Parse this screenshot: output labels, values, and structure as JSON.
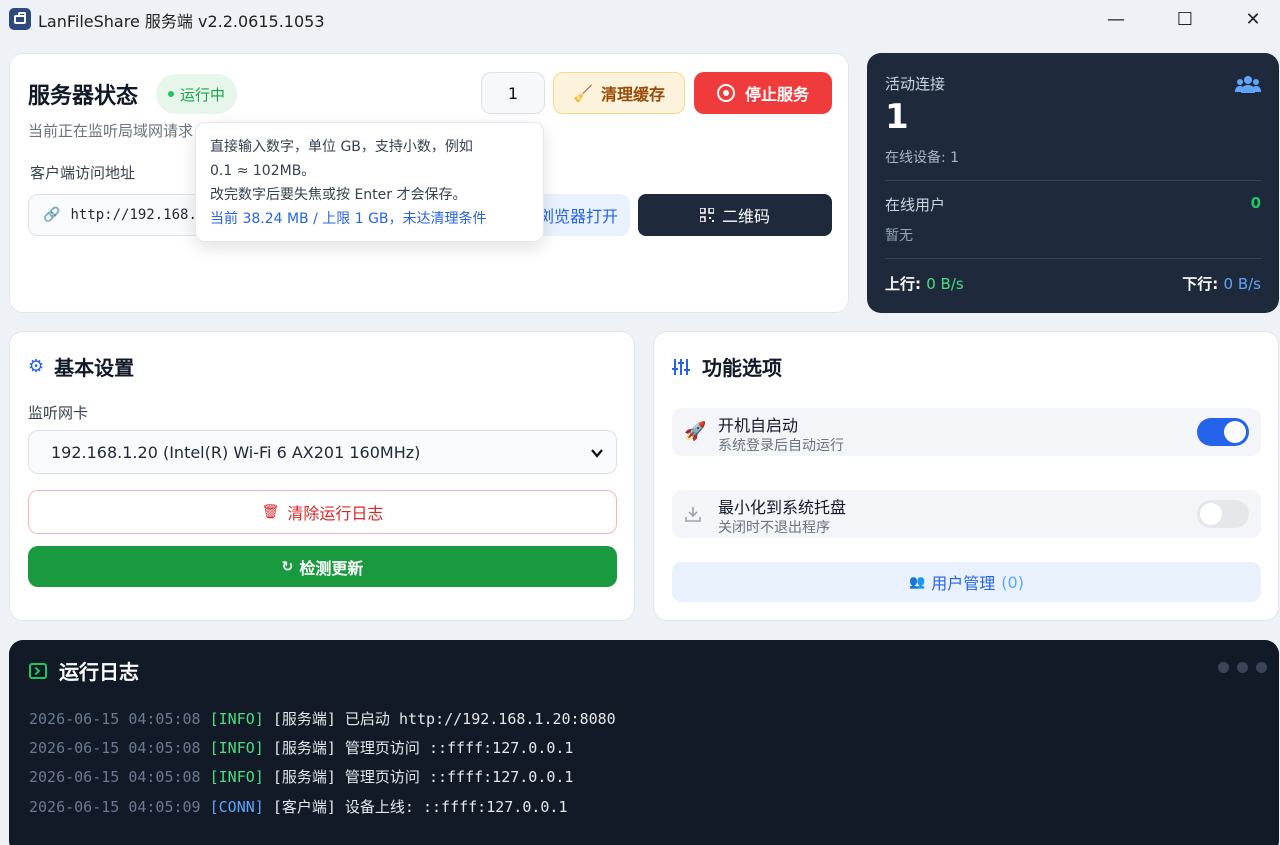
{
  "window": {
    "title": "LanFileShare 服务端 v2.2.0615.1053",
    "minimize": "—",
    "maximize": "☐",
    "close": "✕"
  },
  "status": {
    "title": "服务器状态",
    "badge": "运行中",
    "subtitle": "当前正在监听局域网请求",
    "cache_value": "1",
    "clear_cache_label": "清理缓存",
    "stop_label": "停止服务",
    "address_label": "客户端访问地址",
    "address_value": "http://192.168.1.20:8080",
    "open_browser_label": "浏览器打开",
    "qr_label": "二维码"
  },
  "tooltip": {
    "line1": "直接输入数字，单位 GB，支持小数，例如",
    "line2": "0.1 ≈ 102MB。",
    "line3": "改完数字后要失焦或按 Enter 才会保存。",
    "line4": "当前 38.24 MB / 上限 1 GB，未达清理条件"
  },
  "connections": {
    "label": "活动连接",
    "count": "1",
    "online_devices": "在线设备: 1",
    "online_users_label": "在线用户",
    "online_users_count": "0",
    "online_users_none": "暂无",
    "up_label": "上行:",
    "up_value": "0 B/s",
    "down_label": "下行:",
    "down_value": "0 B/s"
  },
  "basic": {
    "title": "基本设置",
    "nic_label": "监听网卡",
    "nic_value": "192.168.1.20 (Intel(R) Wi-Fi 6 AX201 160MHz)",
    "clear_log_label": "清除运行日志",
    "update_label": "检测更新"
  },
  "features": {
    "title": "功能选项",
    "autostart_title": "开机自启动",
    "autostart_desc": "系统登录后自动运行",
    "autostart_on": true,
    "tray_title": "最小化到系统托盘",
    "tray_desc": "关闭时不退出程序",
    "tray_on": false,
    "user_mgmt_label": "用户管理",
    "user_mgmt_count": "(0)"
  },
  "log": {
    "title": "运行日志",
    "lines": [
      {
        "ts": "2026-06-15 04:05:08",
        "tag": "[INFO]",
        "msg": "[服务端] 已启动 http://192.168.1.20:8080"
      },
      {
        "ts": "2026-06-15 04:05:08",
        "tag": "[INFO]",
        "msg": "[服务端] 管理页访问 ::ffff:127.0.0.1"
      },
      {
        "ts": "2026-06-15 04:05:08",
        "tag": "[INFO]",
        "msg": "[服务端] 管理页访问 ::ffff:127.0.0.1"
      },
      {
        "ts": "2026-06-15 04:05:09",
        "tag": "[CONN]",
        "msg": "[客户端] 设备上线: ::ffff:127.0.0.1"
      }
    ]
  },
  "colors": {
    "accent_blue": "#2563eb",
    "success_green": "#16a34a",
    "danger_red": "#ef3b3b",
    "dark_panel": "#1e2a3b",
    "log_bg": "#121a28"
  }
}
